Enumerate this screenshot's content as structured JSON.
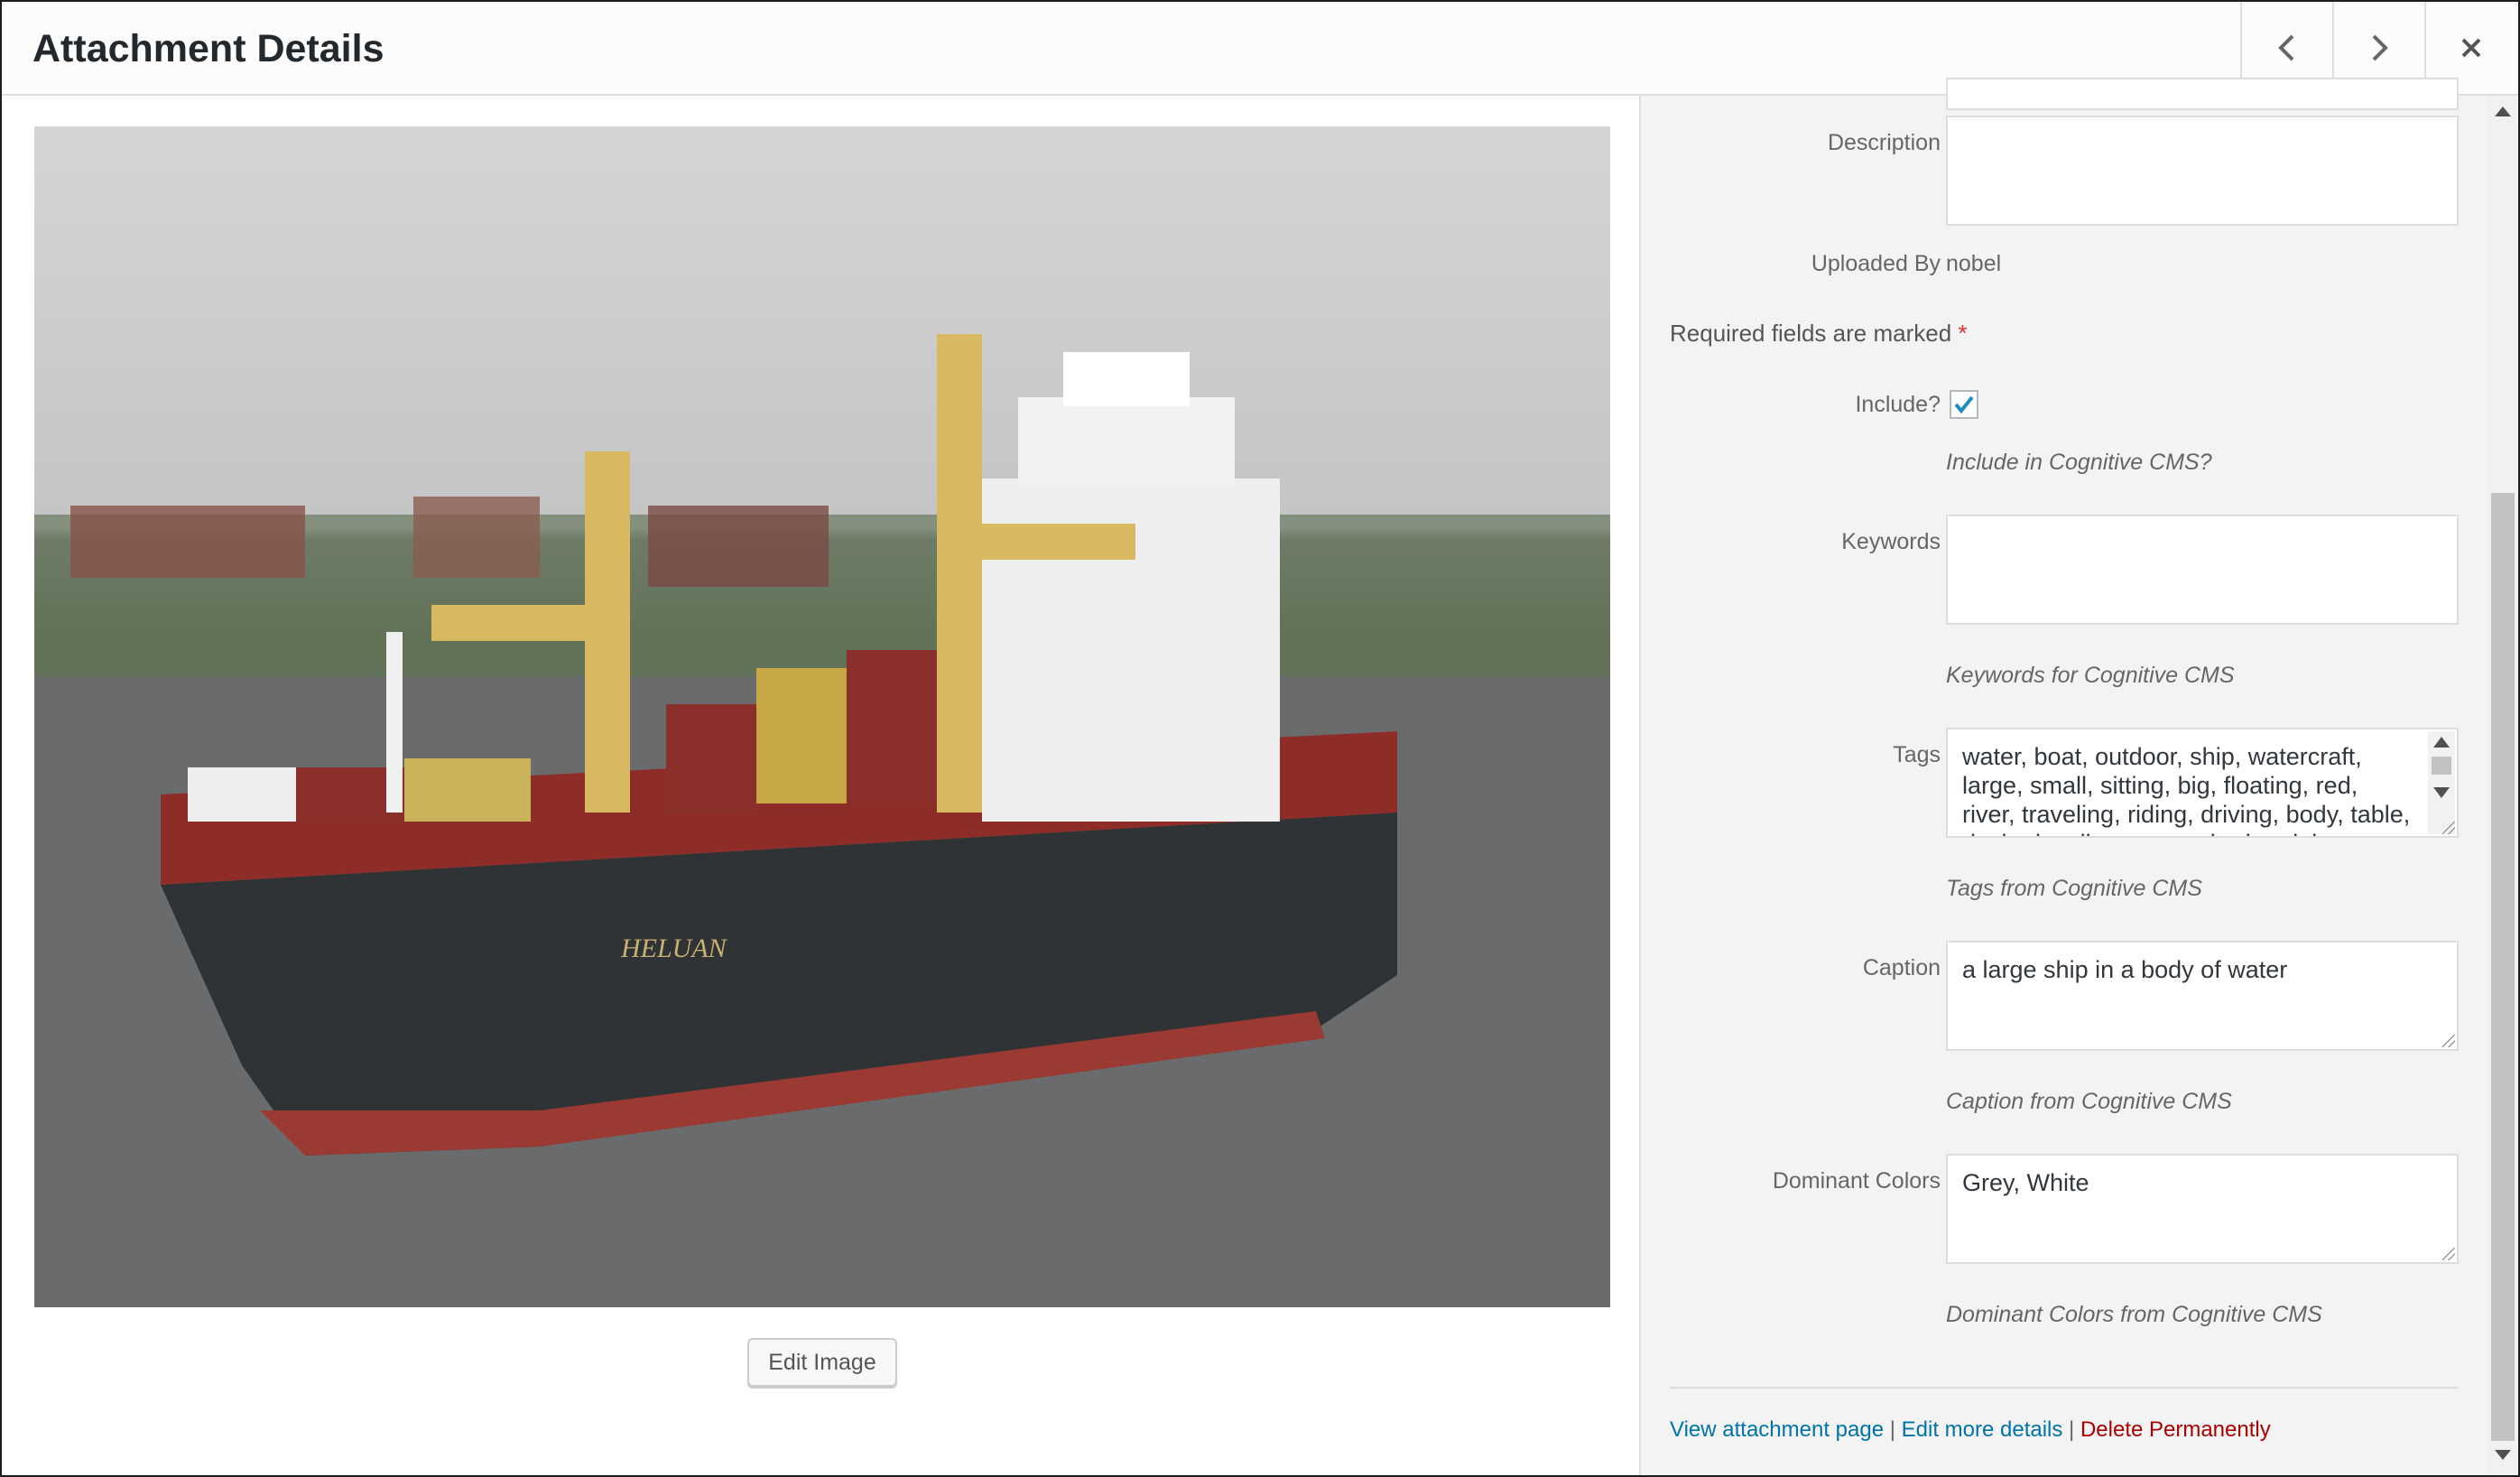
{
  "header": {
    "title": "Attachment Details",
    "prev_icon": "chevron-left-icon",
    "next_icon": "chevron-right-icon",
    "close_icon": "close-icon"
  },
  "image": {
    "edit_button": "Edit Image",
    "ship_name": "HELUAN"
  },
  "details": {
    "description_label": "Description",
    "description_value": "",
    "uploaded_by_label": "Uploaded By",
    "uploaded_by_value": "nobel",
    "required_note": "Required fields are marked",
    "required_marker": "*",
    "include_label": "Include?",
    "include_checked": true,
    "include_help": "Include in Cognitive CMS?",
    "keywords_label": "Keywords",
    "keywords_value": "",
    "keywords_help": "Keywords for Cognitive CMS",
    "tags_label": "Tags",
    "tags_value": "water, boat, outdoor, ship, watercraft, large, small, sitting, big, floating, red, river, traveling, riding, driving, body, table, docked, yellow, group, harbor, lake",
    "tags_help": "Tags from Cognitive CMS",
    "caption_label": "Caption",
    "caption_value": "a large ship in a body of water",
    "caption_help": "Caption from Cognitive CMS",
    "colors_label": "Dominant Colors",
    "colors_value": "Grey, White",
    "colors_help": "Dominant Colors from Cognitive CMS"
  },
  "actions": {
    "view_link": "View attachment page",
    "separator": "|",
    "edit_link": "Edit more details",
    "delete_link": "Delete Permanently"
  },
  "colors": {
    "link": "#0073aa",
    "delete": "#aa0000",
    "required": "#dc3232",
    "checkmark": "#1e8cbe"
  }
}
